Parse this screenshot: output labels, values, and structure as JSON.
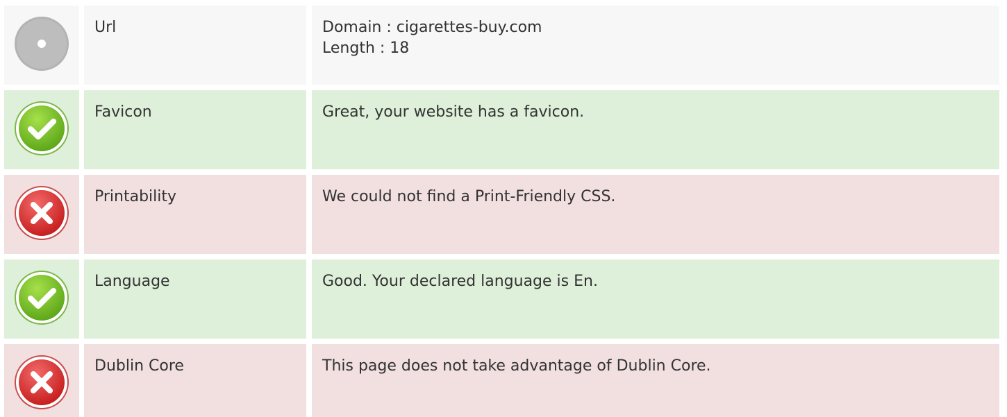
{
  "rows": [
    {
      "status": "neutral",
      "icon": "info-dot-icon",
      "label": "Url",
      "lines": [
        "Domain : cigarettes-buy.com",
        "Length : 18"
      ]
    },
    {
      "status": "pass",
      "icon": "check-circle-icon",
      "label": "Favicon",
      "lines": [
        "Great, your website has a favicon."
      ]
    },
    {
      "status": "fail",
      "icon": "cross-circle-icon",
      "label": "Printability",
      "lines": [
        "We could not find a Print-Friendly CSS."
      ]
    },
    {
      "status": "pass",
      "icon": "check-circle-icon",
      "label": "Language",
      "lines": [
        "Good. Your declared language is En."
      ]
    },
    {
      "status": "fail",
      "icon": "cross-circle-icon",
      "label": "Dublin Core",
      "lines": [
        "This page does not take advantage of Dublin Core."
      ]
    }
  ],
  "colors": {
    "neutral_bg": "#f7f7f7",
    "pass_bg": "#def0da",
    "fail_bg": "#f2dfe0",
    "pass_icon": "#7cc32a",
    "fail_icon": "#e03a3a",
    "neutral_icon": "#b5b5b5"
  }
}
